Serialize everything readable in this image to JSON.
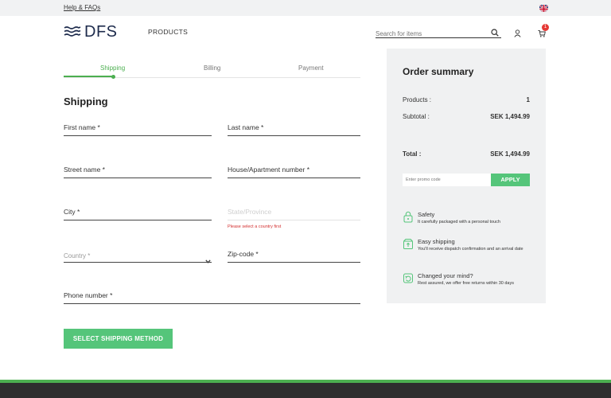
{
  "topbar": {
    "help_link": "Help & FAQs",
    "language_icon": "uk-flag-icon"
  },
  "header": {
    "logo_text": "DFS",
    "nav_products": "PRODUCTS",
    "search_placeholder": "Search for items",
    "cart_count": "1"
  },
  "steps": [
    {
      "label": "Shipping",
      "active": true
    },
    {
      "label": "Billing",
      "active": false
    },
    {
      "label": "Payment",
      "active": false
    }
  ],
  "form": {
    "title": "Shipping",
    "first_name": "First name *",
    "last_name": "Last name *",
    "street_name": "Street name *",
    "house_number": "House/Apartment number *",
    "city": "City *",
    "state": "State/Province",
    "state_error": "Please select a country first",
    "country": "Country *",
    "zip": "Zip-code *",
    "phone": "Phone number *",
    "submit": "SELECT SHIPPING METHOD"
  },
  "summary": {
    "title": "Order summary",
    "products_label": "Products :",
    "products_value": "1",
    "subtotal_label": "Subtotal :",
    "subtotal_value": "SEK 1,494.99",
    "total_label": "Total :",
    "total_value": "SEK 1,494.99",
    "promo_placeholder": "Enter promo code",
    "apply_label": "APPLY",
    "perks": [
      {
        "icon": "lock-icon",
        "title": "Safety",
        "desc": "It carefully packaged with a personal touch"
      },
      {
        "icon": "box-icon",
        "title": "Easy shipping",
        "desc": "You'll receive dispatch confirmation and an arrival date"
      },
      {
        "icon": "return-icon",
        "title": "Changed your mind?",
        "desc": "Rest assured, we offer free returns within 30 days"
      }
    ]
  },
  "colors": {
    "accent": "#55c57a",
    "step_active": "#4caf50",
    "error": "#d32f2f",
    "footer": "#2e2e2e"
  }
}
